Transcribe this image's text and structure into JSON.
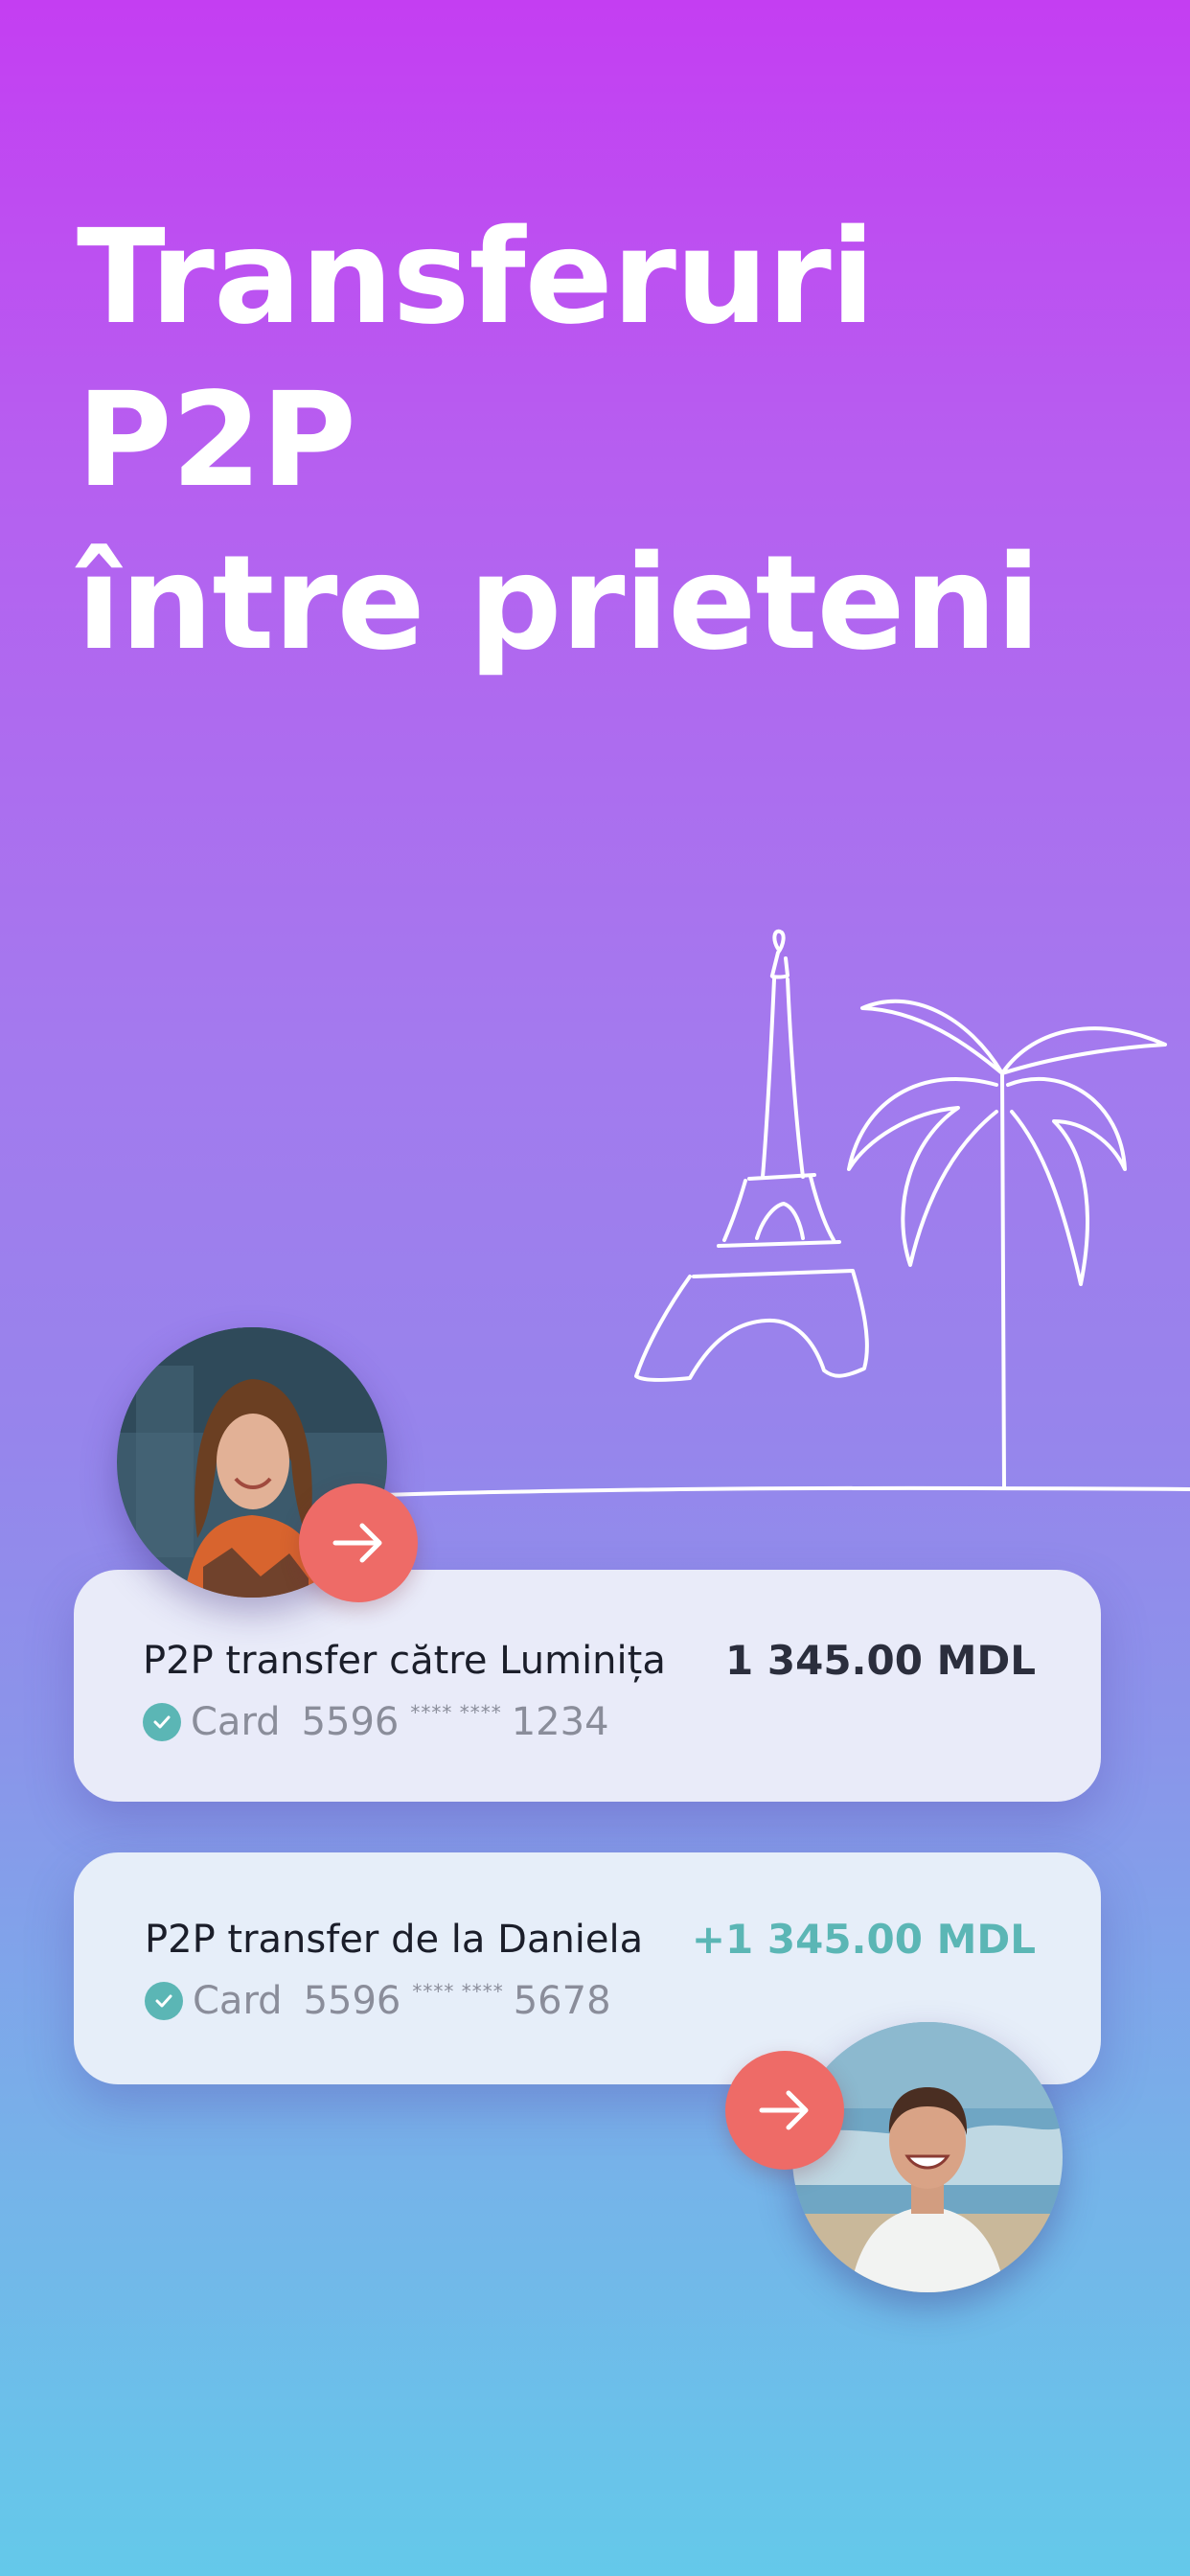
{
  "headline": {
    "line1": "Transferuri P2P",
    "line2": "între prieteni"
  },
  "colors": {
    "accent_teal": "#5bb6b5",
    "arrow_button": "#ee6b67",
    "gradient_top": "#c43ef2",
    "gradient_bottom": "#64c9ea"
  },
  "transfers": [
    {
      "title": "P2P transfer către Luminița",
      "amount": "1 345.00 MDL",
      "method_label": "Card",
      "pan_start": "5596",
      "pan_mask": "**** ****",
      "pan_end": "1234",
      "avatar_icon": "user-avatar-luminita",
      "action_icon": "arrow-right-icon"
    },
    {
      "title": "P2P transfer de la Daniela",
      "amount": "+1 345.00 MDL",
      "method_label": "Card",
      "pan_start": "5596",
      "pan_mask": "**** ****",
      "pan_end": "5678",
      "avatar_icon": "user-avatar-daniela",
      "action_icon": "arrow-right-icon"
    }
  ]
}
